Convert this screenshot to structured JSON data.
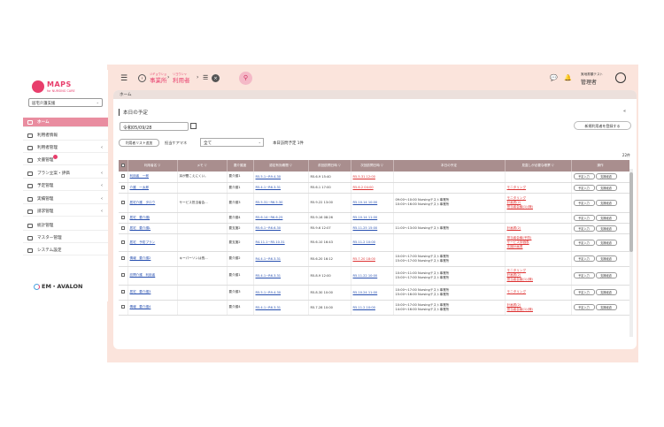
{
  "sidebar": {
    "logo": "MAPS",
    "logo_sub": "for NURSING CARE",
    "service": "居宅介護支援",
    "items": [
      {
        "label": "ホーム"
      },
      {
        "label": "利用者情報"
      },
      {
        "label": "利用者管理"
      },
      {
        "label": "文書管理"
      },
      {
        "label": "プラン立案・評価"
      },
      {
        "label": "予定管理"
      },
      {
        "label": "実績管理"
      },
      {
        "label": "請求管理"
      },
      {
        "label": "統計管理"
      },
      {
        "label": "マスター管理"
      },
      {
        "label": "システム設定"
      }
    ],
    "footer_logo": "EM・AVALON"
  },
  "topbar": {
    "ruby1": "ジギョウショ",
    "crumb1": "事業所",
    "ruby2": "リヨウシャ",
    "crumb2": "利用者",
    "user_sub": "実地書類テスト",
    "user_name": "管理者"
  },
  "main": {
    "breadcrumb": "ホーム",
    "title": "本日の予定",
    "date": "令和05/09/28",
    "new_button": "新規利用者を登録する",
    "add_list_button": "利用者リスト追加",
    "cm_label": "担当ケアマネ",
    "cm_value": "全て",
    "visit_count": "本日訪問予定 1件",
    "total": "22件"
  },
  "table": {
    "headers": [
      "",
      "利用者名",
      "メモ",
      "要介護度",
      "認定有効期間",
      "前回訪問日時",
      "次回訪問日時",
      "本日の予定",
      "見直しが必要な帳票",
      "操作"
    ],
    "btn1": "予定入力",
    "btn2": "支援経過",
    "rows": [
      {
        "name": "利用者　一郎",
        "memo": "耳が聞こえにくい。",
        "level": "要介護1",
        "period": "R5.5.1~R9.4.30",
        "last": "R5.6.9 15:40",
        "next": "R5.5.31 12:00",
        "next_red": true,
        "plan": [],
        "forms": []
      },
      {
        "name": "介護　一太郎",
        "memo": "",
        "level": "要介護1",
        "period": "R5.4.1~R6.3.31",
        "last": "R5.6.1 17:00",
        "next": "R5.6.2 04:00",
        "next_red": true,
        "plan": [],
        "forms": [
          "モニタリング"
        ]
      },
      {
        "name": "居宅介護　タロウ",
        "memo": "サービス担当者会...",
        "level": "要介護3",
        "period": "R5.5.31~R6.5.30",
        "last": "R5.9.22 13:00",
        "next": "R5.10.14 10:00",
        "next_red": false,
        "plan": [
          "09:00～10:00 Nursingテスト事業所",
          "10:00～16:00 Nursingテスト事業所"
        ],
        "forms": [
          "モニタリング",
          "計画書(2)",
          "担当者会議(1)(様)"
        ]
      },
      {
        "name": "居宅　要介護J",
        "memo": "",
        "level": "要介護4",
        "period": "R5.6.14~R6.6.25",
        "last": "R5.9.16 08:26",
        "next": "R5.10.14 11:00",
        "next_red": false,
        "plan": [],
        "forms": []
      },
      {
        "name": "居宅　要介護L",
        "memo": "",
        "level": "要支援2",
        "period": "R5.6.1~R6.6.30",
        "last": "R5.9.6 12:07",
        "next": "R5.11.25 15:00",
        "next_red": false,
        "plan": [
          "11:00～13:00 Nursingテスト事業所"
        ],
        "forms": [
          "計画書(2)"
        ]
      },
      {
        "name": "居宅　予防プラン",
        "memo": "",
        "level": "要支援2",
        "period": "R4.11.1~R5.10.31",
        "last": "R5.6.10 16:43",
        "next": "R5.11.2 10:00",
        "next_red": false,
        "plan": [],
        "forms": [
          "担当者会議(予防)",
          "サービス評価表",
          "支援計画書"
        ]
      },
      {
        "name": "情報　要介護2",
        "memo": "キーパーソンは長...",
        "level": "要介護2",
        "period": "R4.4.1~R6.3.31",
        "last": "R5.6.20 16:12",
        "next": "R5.7.20 18:00",
        "next_red": true,
        "plan": [
          "10:00～17:00 Nursingテスト事業所",
          "15:00～17:00 Nursingテスト事業所"
        ],
        "forms": []
      },
      {
        "name": "訪問介護　利用者",
        "memo": "",
        "level": "要介護1",
        "period": "R5.4.1~R6.3.31",
        "last": "R5.8.9 12:00",
        "next": "R5.11.22 10:00",
        "next_red": false,
        "plan": [
          "10:00～11:00 Nursingテスト事業所",
          "15:00～17:00 Nursingテスト事業所"
        ],
        "forms": [
          "モニタリング",
          "計画書(2)",
          "担当者会議(1)(様)"
        ]
      },
      {
        "name": "居宅　要介護3",
        "memo": "",
        "level": "要介護3",
        "period": "R5.5.1~R9.4.30",
        "last": "R5.8.30 10:00",
        "next": "R5.10.24 11:00",
        "next_red": false,
        "plan": [
          "10:00～17:00 Nursingテスト事業所",
          "15:00～16:00 Nursingテスト事業所"
        ],
        "forms": [
          "モニタリング"
        ]
      },
      {
        "name": "情報　要介護4",
        "memo": "",
        "level": "要介護4",
        "period": "R5.4.1~R6.3.31",
        "last": "R5.7.28 10:00",
        "next": "R5.11.2 10:00",
        "next_red": false,
        "plan": [
          "10:00～17:00 Nursingテスト事業所",
          "14:00～16:00 Nursingテスト事業所"
        ],
        "forms": [
          "計画書(2)",
          "担当者会議(1)(様)"
        ]
      }
    ]
  }
}
